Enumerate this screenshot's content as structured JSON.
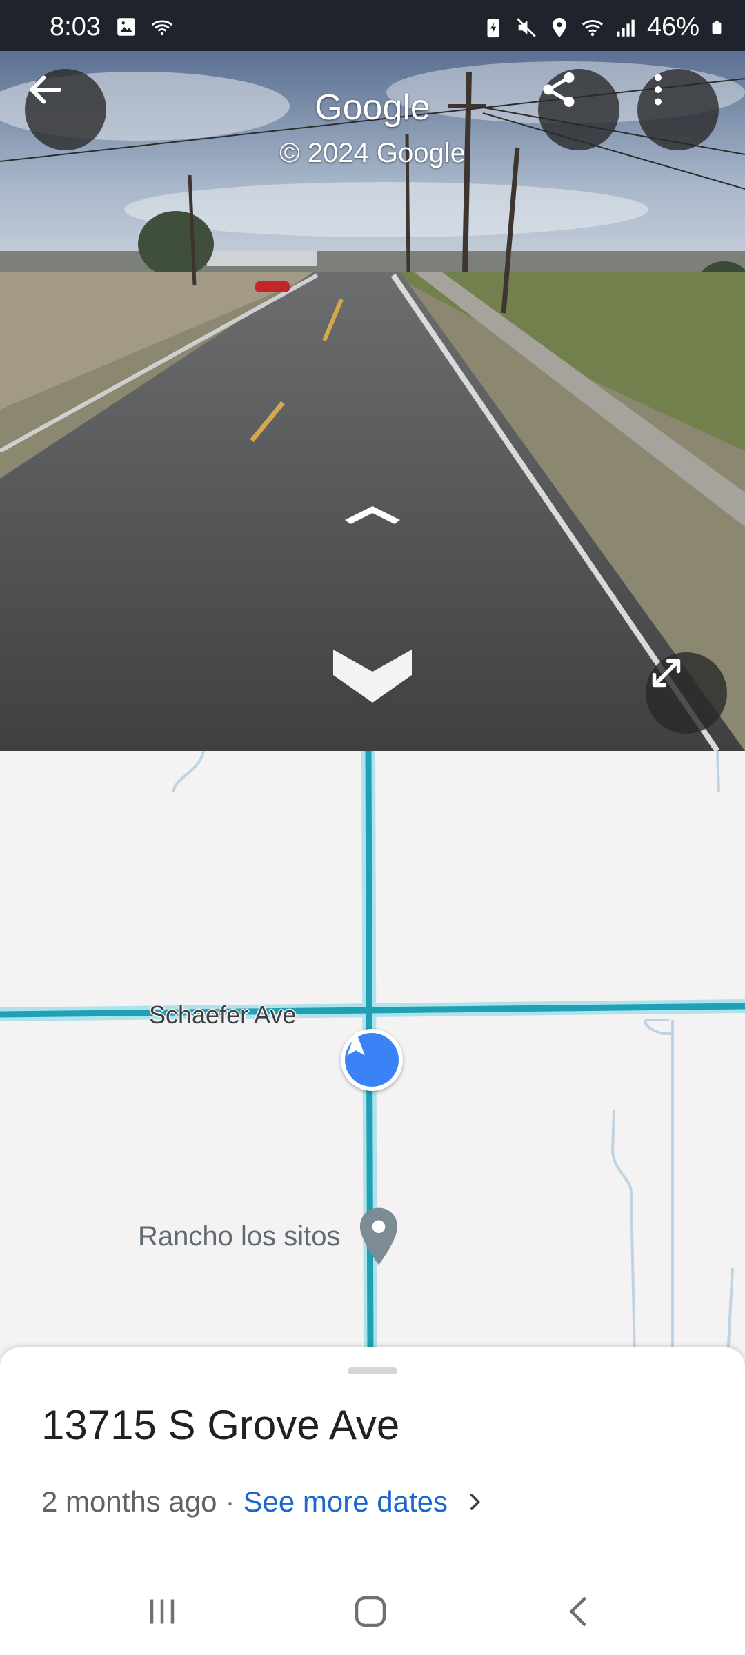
{
  "status_bar": {
    "time": "8:03",
    "battery": "46%",
    "icons": [
      "gallery-icon",
      "wifi-direct-icon",
      "battery-saver-icon",
      "mute-icon",
      "location-icon",
      "wifi-icon",
      "signal-icon",
      "battery-icon"
    ]
  },
  "streetview": {
    "brand": "Google",
    "copyright": "© 2024 Google",
    "buttons": [
      "back-arrow-icon",
      "share-icon",
      "more-vert-icon",
      "expand-icon"
    ]
  },
  "map": {
    "street_label": "Schaefer Ave",
    "place_label": "Rancho los sitos",
    "colors": {
      "road": "#20a0b4",
      "road_glow": "#aee3ec",
      "marker": "#3b82f6",
      "pin": "#7d8b95"
    }
  },
  "sheet": {
    "address": "13715 S Grove Ave",
    "age": "2 months ago",
    "separator": "·",
    "see_more": "See more dates"
  },
  "nav": {
    "buttons": [
      "recents-icon",
      "home-icon",
      "back-icon"
    ]
  }
}
